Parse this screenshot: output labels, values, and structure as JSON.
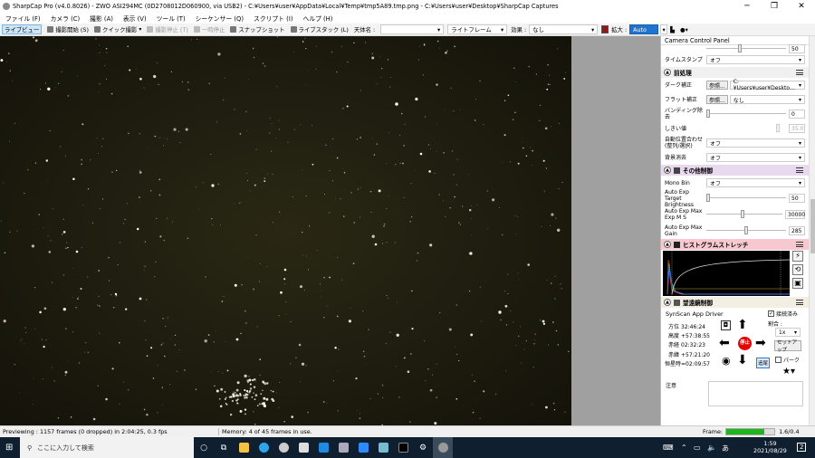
{
  "window": {
    "title": "SharpCap Pro (v4.0.8026) - ZWO ASI294MC (0D2708012D060900, via USB2) - C:¥Users¥user¥AppData¥Local¥Temp¥tmp5A89.tmp.png - C:¥Users¥user¥Desktop¥SharpCap Captures",
    "minimize": "─",
    "restore": "❐",
    "close": "✕"
  },
  "menu": [
    "ファイル (F)",
    "カメラ (C)",
    "撮影 (A)",
    "表示 (V)",
    "ツール (T)",
    "シーケンサー (Q)",
    "スクリプト (I)",
    "ヘルプ (H)"
  ],
  "toolbar": {
    "live": "ライブビュー",
    "start_capture": "撮影開始 (S)",
    "quick_capture": "クイック撮影",
    "stop_capture": "撮影停止 (T)",
    "pause": "一時停止",
    "snapshot": "スナップショット",
    "live_stack": "ライブスタック (L)",
    "target_label": "天体名 :",
    "target_value": "",
    "frame_type": "ライトフレーム",
    "effect_label": "効果 :",
    "effect_value": "なし",
    "zoom_label": "拡大 :",
    "zoom_value": "Auto",
    "swatch_color": "#8b1a1a"
  },
  "panel": {
    "title": "Camera Control Panel",
    "top_partial_value": "50",
    "timestamp_label": "タイムスタンプ",
    "timestamp_value": "オフ",
    "preprocess": {
      "header": "前処理",
      "dark_label": "ダーク補正",
      "dark_btn": "参照...",
      "dark_value": "C:¥Users¥user¥Deskto…",
      "flat_label": "フラット補正",
      "flat_btn": "参照...",
      "flat_value": "なし",
      "banding_label": "バンディング除去",
      "banding_value": "0",
      "threshold_label": "しきい値",
      "threshold_value": "35.0",
      "align_label": "自動位置合わせ (整列/選択)",
      "align_value": "オフ",
      "bg_label": "背景消去",
      "bg_value": "オフ"
    },
    "other": {
      "header": "その他制御",
      "mono_label": "Mono Bin",
      "mono_value": "オフ",
      "target_bright_label": "Auto Exp Target Brightness",
      "target_bright_value": "50",
      "max_exp_label": "Auto Exp Max Exp M S",
      "max_exp_value": "30000",
      "max_gain_label": "Auto Exp Max Gain",
      "max_gain_value": "285"
    },
    "histogram": {
      "header": "ヒストグラムストレッチ"
    },
    "scope": {
      "header": "望遠鏡制御",
      "driver": "SynScan App Driver",
      "slewing_label": "接続済み",
      "rate_label": "割合 :",
      "rate_value": "1x",
      "az_label": "方位",
      "az_value": "32:46:24",
      "alt_label": "高度",
      "alt_value": "+57:38:55",
      "ra_label": "赤経",
      "ra_value": "02:32:23",
      "dec_label": "赤緯",
      "dec_value": "+57:21:20",
      "lst_label": "恒星時",
      "lst_value": "=02:09:57",
      "stop_label": "停止",
      "setup_label": "セットアップ",
      "park_label": "パーク",
      "track_label": "追尾",
      "notes_label": "注意"
    }
  },
  "status": {
    "previewing": "Previewing : 1157 frames (0 dropped) in 2:04:25, 0.3 fps",
    "memory": "Memory: 4 of 45 frames in use.",
    "frame_label": "Frame:",
    "frame_progress": 0.8,
    "frame_value": "1.6/0.4"
  },
  "taskbar": {
    "search_placeholder": "ここに入力して検索",
    "time": "1:59",
    "date": "2021/08/29",
    "notifications": "2"
  }
}
